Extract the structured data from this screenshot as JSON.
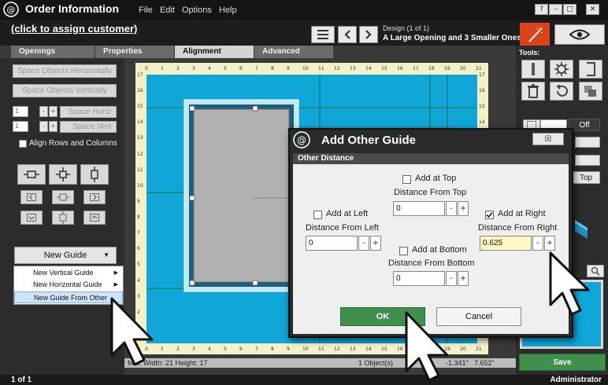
{
  "app": {
    "title": "Order Information"
  },
  "menu": [
    "File",
    "Edit",
    "Options",
    "Help"
  ],
  "header": {
    "customer_link": "(click to assign customer)",
    "design_counter": "Design  (1 of 1)",
    "design_name": "A Large Opening and 3 Smaller Ones"
  },
  "tabs": [
    "Openings",
    "Properties",
    "Alignment",
    "Advanced"
  ],
  "left": {
    "space_h": "Space Objects Horizontally",
    "space_v": "Space Objects Vertically",
    "spin1_value": "1",
    "spin2_value": "1",
    "space_horiz": "Space Horiz",
    "space_vert": "Space Vert",
    "align_rows": "Align Rows and Columns",
    "new_guide": "New Guide",
    "ctx": [
      "New Vertical Guide",
      "New Horizontal Guide",
      "New Guide From Other"
    ]
  },
  "canvas": {
    "ruler_top": [
      "0",
      "1",
      "2",
      "3",
      "4",
      "5",
      "6",
      "7",
      "8",
      "9",
      "10",
      "11",
      "12",
      "13",
      "14",
      "15",
      "16",
      "17",
      "18",
      "19",
      "20",
      "21"
    ],
    "ruler_left": [
      "17",
      "16",
      "15",
      "14",
      "13",
      "12",
      "11",
      "10",
      "9",
      "8",
      "7",
      "6",
      "5",
      "4",
      "3",
      "2",
      "1"
    ],
    "mat_info": "Mat: Width: 21  Height: 17",
    "objects": "1 Object(s)",
    "coord_x": "-1.341\"",
    "coord_y": "7.652\""
  },
  "tools": {
    "label": "Tools:",
    "off": "Off",
    "top": "Top",
    "save": "Save"
  },
  "status": {
    "page": "1 of 1",
    "user": "Administrator"
  },
  "dialog": {
    "title": "Add Other Guide",
    "close": "☒",
    "section": "Other Distance",
    "top_check": "Add at Top",
    "top_label": "Distance From Top",
    "top_value": "0",
    "left_check": "Add at Left",
    "left_label": "Distance From Left",
    "left_value": "0",
    "right_check": "Add at Right",
    "right_label": "Distance From Right",
    "right_value": "0.625",
    "bottom_check": "Add at Bottom",
    "bottom_label": "Distance From Bottom",
    "bottom_value": "0",
    "ok": "OK",
    "cancel": "Cancel"
  },
  "colors": {
    "mat": "#10a6d8",
    "accent_green": "#3f8f4d",
    "wand": "#d9421b",
    "ruler": "#f4f0c8"
  }
}
